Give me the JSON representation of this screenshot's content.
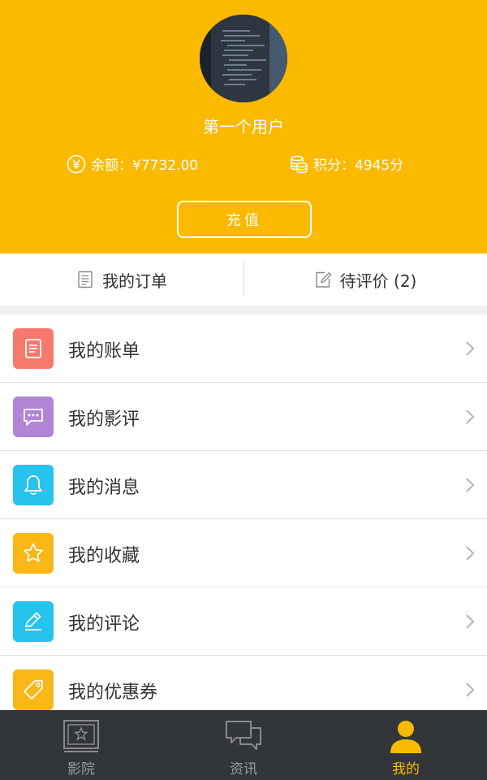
{
  "profile": {
    "username": "第一个用户",
    "balance_text": "余额：¥7732.00",
    "points_text": "积分：4945分",
    "recharge_label": "充值"
  },
  "tabs": [
    {
      "label": "我的订单",
      "icon": "list-icon"
    },
    {
      "label": "待评价 (2)",
      "icon": "edit-icon"
    }
  ],
  "menu": [
    {
      "label": "我的账单",
      "icon": "bill-icon",
      "color": "#f67a6c"
    },
    {
      "label": "我的影评",
      "icon": "comment-icon",
      "color": "#b184d6"
    },
    {
      "label": "我的消息",
      "icon": "bell-icon",
      "color": "#25c3ed"
    },
    {
      "label": "我的收藏",
      "icon": "star-icon",
      "color": "#fbb617"
    },
    {
      "label": "我的评论",
      "icon": "pencil-icon",
      "color": "#25c3ed"
    },
    {
      "label": "我的优惠券",
      "icon": "tag-icon",
      "color": "#fbb617"
    }
  ],
  "tabbar": [
    {
      "label": "影院",
      "icon": "cinema-icon",
      "active": false
    },
    {
      "label": "资讯",
      "icon": "chat-icon",
      "active": false
    },
    {
      "label": "我的",
      "icon": "person-icon",
      "active": true
    }
  ],
  "colors": {
    "brand": "#fbb900",
    "tabbar_bg": "#32363a"
  }
}
